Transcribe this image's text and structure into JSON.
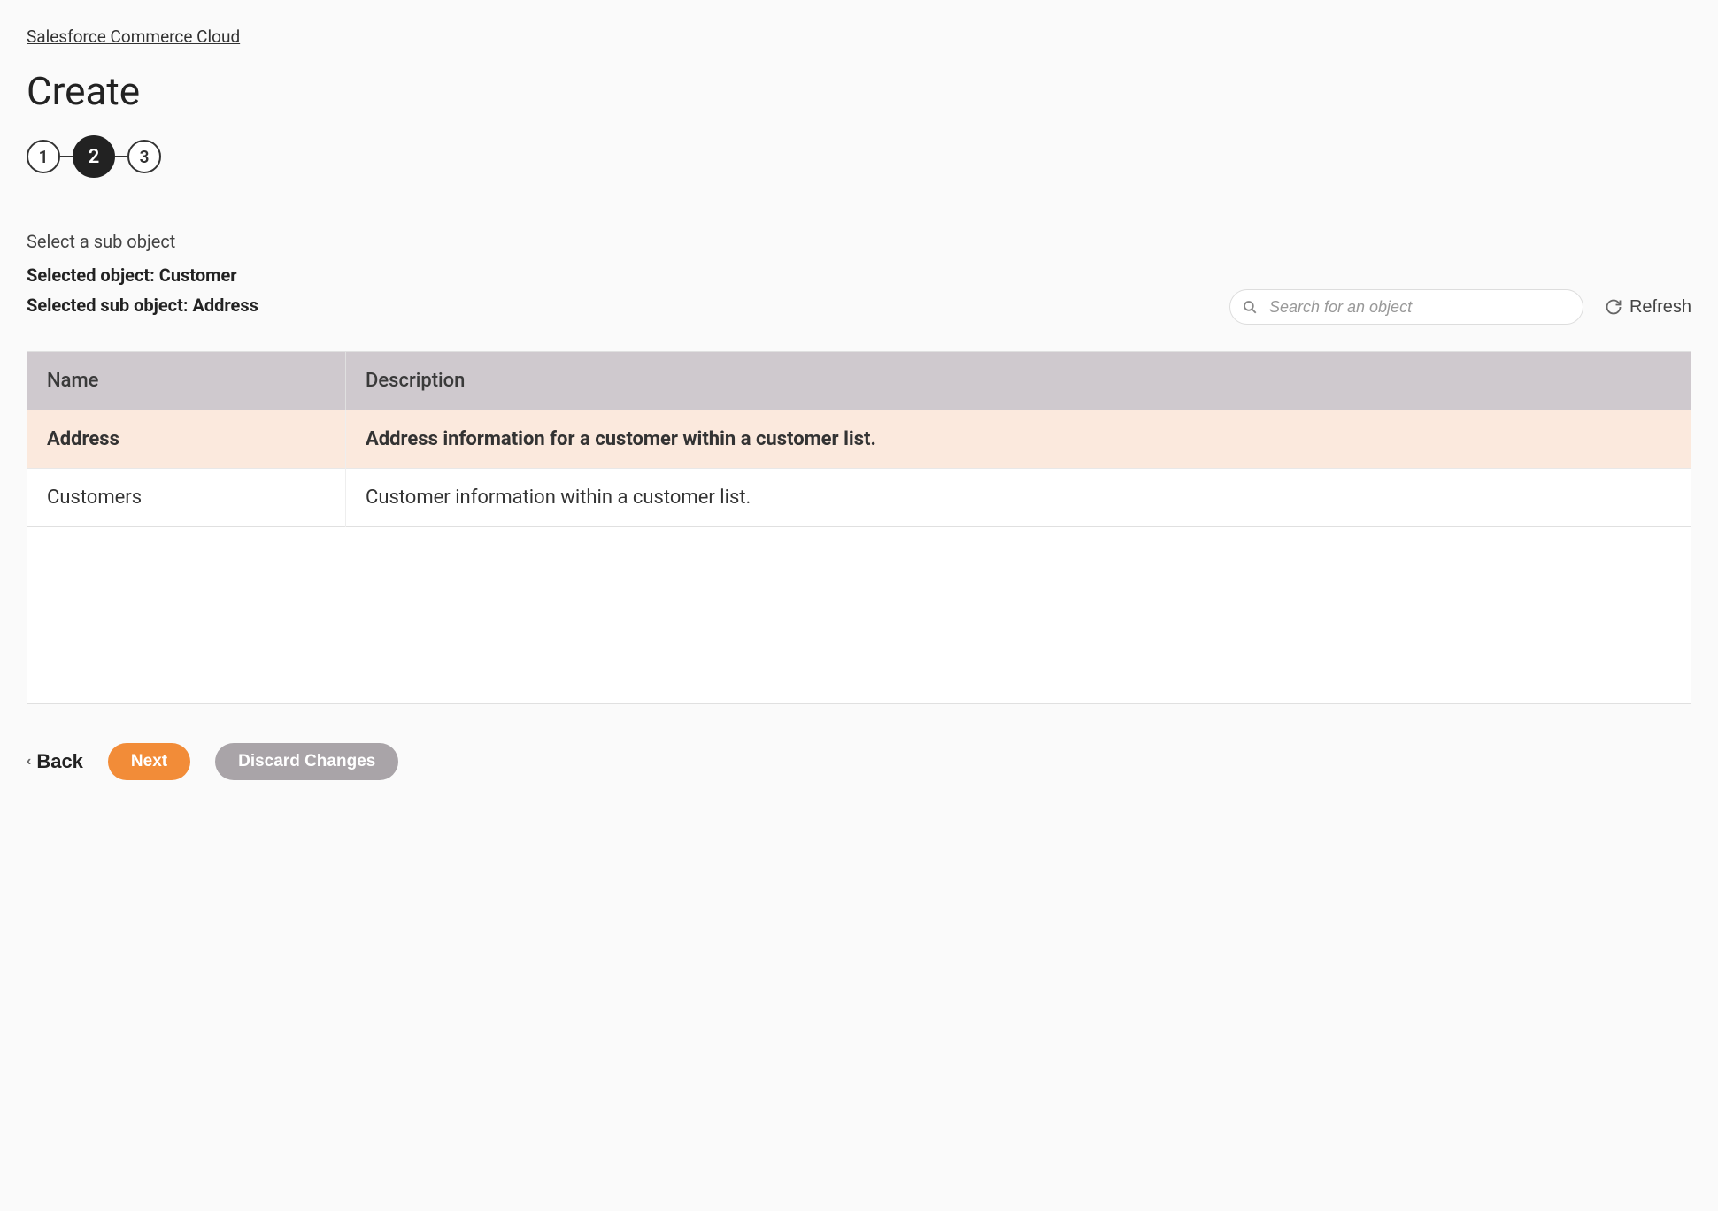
{
  "breadcrumb": {
    "label": "Salesforce Commerce Cloud"
  },
  "page": {
    "title": "Create"
  },
  "stepper": {
    "steps": [
      "1",
      "2",
      "3"
    ],
    "active_index": 1
  },
  "instructions": {
    "subtitle": "Select a sub object",
    "selected_object_label": "Selected object: Customer",
    "selected_sub_object_label": "Selected sub object: Address"
  },
  "search": {
    "placeholder": "Search for an object"
  },
  "refresh": {
    "label": "Refresh"
  },
  "table": {
    "headers": {
      "name": "Name",
      "description": "Description"
    },
    "rows": [
      {
        "name": "Address",
        "description": "Address information for a customer within a customer list.",
        "selected": true
      },
      {
        "name": "Customers",
        "description": "Customer information within a customer list.",
        "selected": false
      }
    ]
  },
  "footer": {
    "back_label": "Back",
    "next_label": "Next",
    "discard_label": "Discard Changes"
  }
}
